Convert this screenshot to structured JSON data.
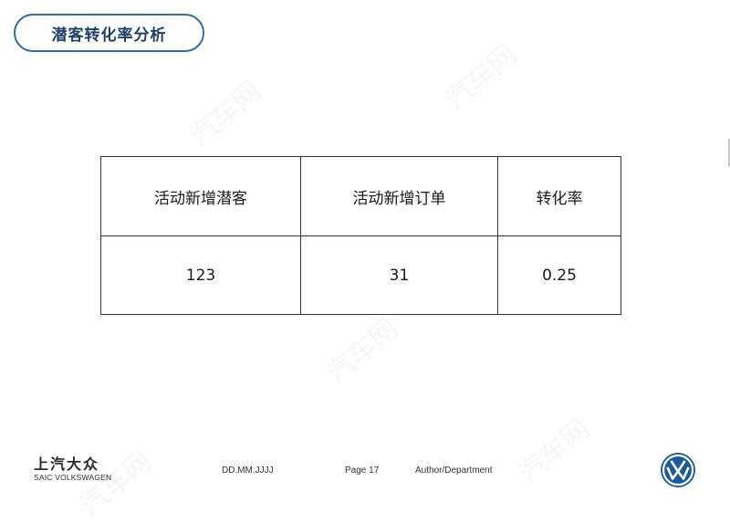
{
  "header": {
    "title": "潜客转化率分析"
  },
  "table": {
    "headers": [
      "活动新增潜客",
      "活动新增订单",
      "转化率"
    ],
    "rows": [
      [
        "123",
        "31",
        "0.25"
      ]
    ]
  },
  "watermark": {
    "text": "汽车网"
  },
  "footer": {
    "brand_cn": "上汽大众",
    "brand_en": "SAIC VOLKSWAGEN",
    "date": "DD.MM.JJJJ",
    "page": "Page 17",
    "author": "Author/Department",
    "logo_icon": "volkswagen-logo-icon"
  },
  "colors": {
    "title_border": "#2f6f9f",
    "title_text": "#1d3f66",
    "vw_blue": "#1b5a9e"
  }
}
